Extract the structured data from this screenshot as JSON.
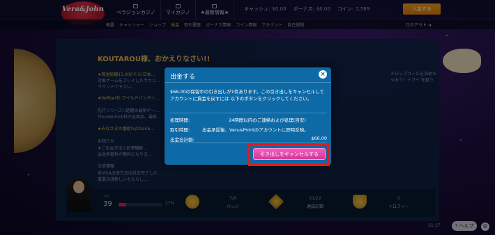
{
  "header": {
    "logo_text": "Vera&John",
    "nav": [
      "ベラジョンカジノ",
      "マイカジノ",
      "★最新情報★"
    ],
    "cash_label": "キャッシュ:",
    "cash_value": "$0.00",
    "bonus_label": "ボーナス:",
    "bonus_value": "$0.00",
    "coin_label": "コイン:",
    "coin_value": "2,589",
    "deposit_label": "入金する"
  },
  "subnav": {
    "links": [
      "概要",
      "キャッシャー",
      "ショップ",
      "出金",
      "取引履歴",
      "ボーナス情報",
      "コイン情報",
      "アカウント",
      "自己規制"
    ],
    "active_index": 3,
    "logout_label": "ログアウト"
  },
  "page": {
    "welcome": "KOUTAROU様、おかえりなさい!!",
    "lines": [
      "★賞金総額15,000ドル(日本...",
      "対象ゲームをプレイしたラウン...",
      "ラウンドで下さい。",
      "★VeRber社 ワイルドバンディ...",
      "先行リリース!!話題の最新ゲー...",
      "Thunderkick社の全商品、最新...",
      "★みなさまの番組!V/Charie...",
      "お知らせ",
      "★ご出金方法に拡張機能...",
      "出金手数料が無料になりま...",
      "決済情報",
      "各VISA決済方法の対応完了した...",
      "重要決済新しいもたらし..."
    ],
    "right_text": "ドロップゴールを決めちゃおう！トライ を狙う"
  },
  "profile": {
    "level_label": "Lv.",
    "level": "39",
    "progress_percent": 17,
    "progress_text": "17%",
    "stats": [
      {
        "value": "7/9",
        "label": "バッジ"
      },
      {
        "value": "21/22",
        "label": "達成記録"
      },
      {
        "value": "0",
        "label": "トロフィー"
      }
    ]
  },
  "footer": {
    "time": "21:17",
    "help_label": "ヘルプ"
  },
  "modal": {
    "title": "出金する",
    "message": "$66.00の保留中の引き出しが1件あります。この引き出しをキャンセルしてアカウントに資金を戻すには 以下のボタンをクリックしてください。",
    "processing_label": "処理時間:",
    "processing_value": "24時間以内のご連絡および処理(目安)",
    "transaction_label": "取引時間:",
    "transaction_value": "出金承認後、VenusPointのアカウントに即時反映。",
    "total_label": "出金合計額:",
    "total_value": "$66.00",
    "cancel_button": "引き出しをキャンセルする",
    "close_icon": "×"
  },
  "colors": {
    "modal_bg": "#0e6aa6",
    "cancel_button": "#e048a9",
    "highlight_border": "#e3191c",
    "deposit_button": "#f29a1c"
  }
}
